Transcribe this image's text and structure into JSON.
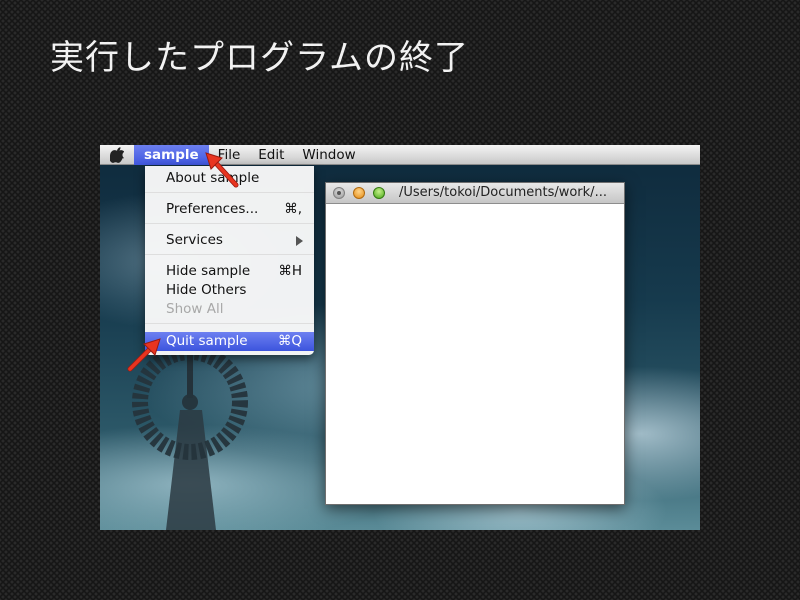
{
  "slide": {
    "title": "実行したプログラムの終了"
  },
  "menubar": {
    "app_menu": "sample",
    "items": [
      "File",
      "Edit",
      "Window"
    ]
  },
  "app_menu": {
    "about": "About sample",
    "preferences": {
      "label": "Preferences...",
      "shortcut": "⌘,"
    },
    "services": "Services",
    "hide": {
      "label": "Hide sample",
      "shortcut": "⌘H"
    },
    "hide_others": "Hide Others",
    "show_all": "Show All",
    "quit": {
      "label": "Quit sample",
      "shortcut": "⌘Q"
    }
  },
  "window": {
    "title": "/Users/tokoi/Documents/work/..."
  },
  "colors": {
    "highlight": "#3f56de",
    "arrow": "#e8341f",
    "slide_background": "#161616"
  },
  "icons": [
    "apple-icon",
    "submenu-arrow-icon",
    "close-icon",
    "minimize-icon",
    "zoom-icon",
    "red-arrow-icon"
  ]
}
